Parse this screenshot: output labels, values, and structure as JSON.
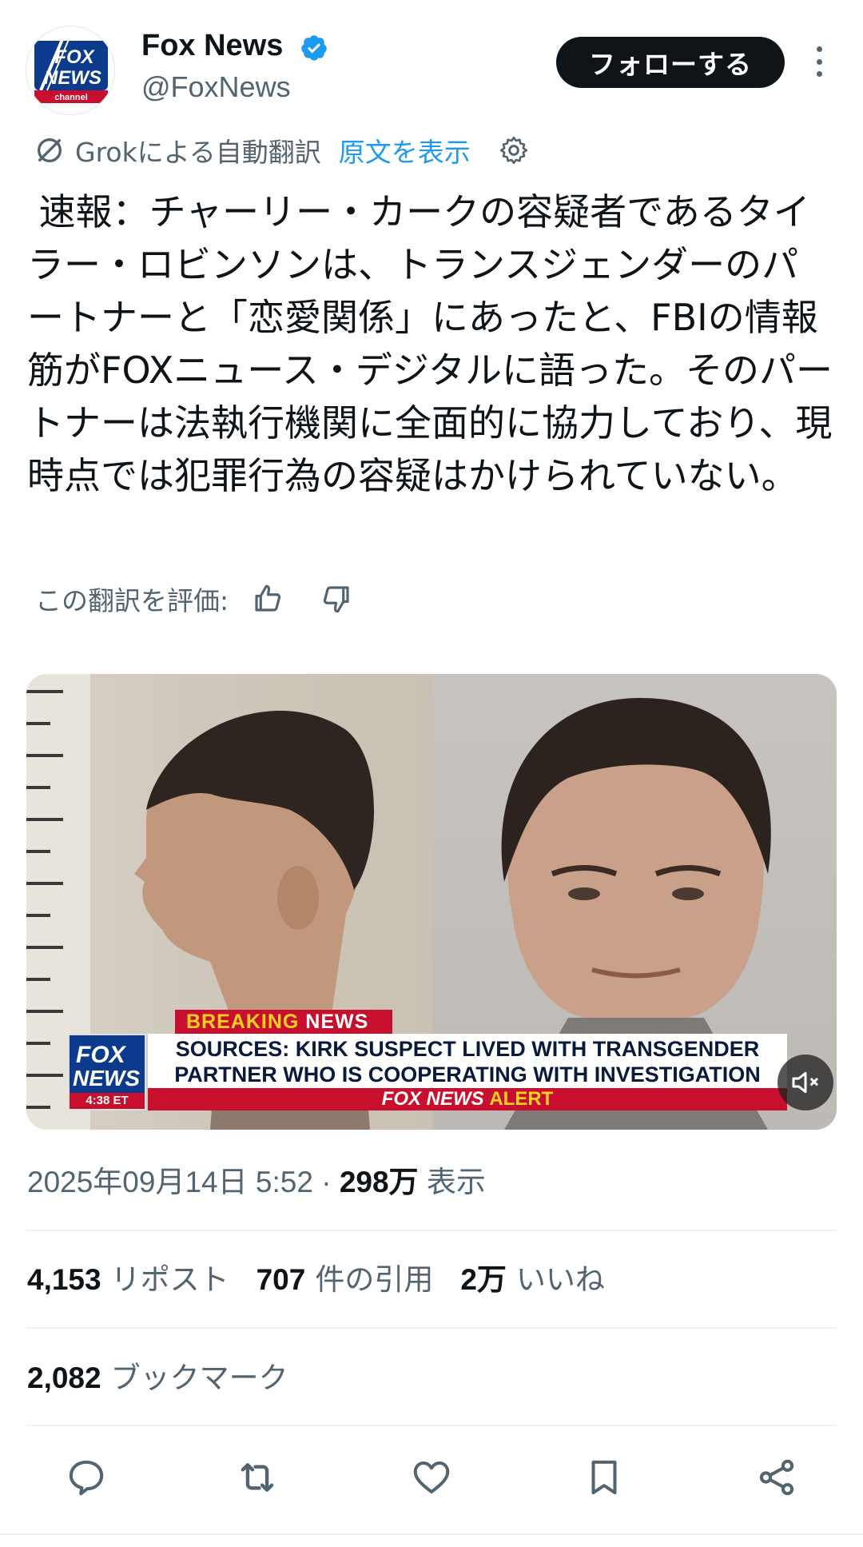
{
  "author": {
    "display_name": "Fox News",
    "handle": "@FoxNews",
    "verified": true,
    "avatar_logo_text": [
      "FOX",
      "NEWS",
      "channel"
    ]
  },
  "header": {
    "follow_label": "フォローする",
    "more_icon": "more-vertical-icon"
  },
  "translation": {
    "grok_label": "Grokによる自動翻訳",
    "show_original_label": "原文を表示",
    "settings_icon": "gear-icon"
  },
  "tweet": {
    "text": " 速報：チャーリー・カークの容疑者であるタイラー・ロビンソンは、トランスジェンダーのパートナーと「恋愛関係」にあったと、FBIの情報筋がFOXニュース・デジタルに語った。そのパートナーは法執行機関に全面的に協力しており、現時点では犯罪行為の容疑はかけられていない。"
  },
  "rate": {
    "label": "この翻訳を評価:",
    "up_icon": "thumbs-up-icon",
    "down_icon": "thumbs-down-icon"
  },
  "media": {
    "breaking_tag_a": "BREAKING",
    "breaking_tag_b": " NEWS",
    "logo_line1": "FOX",
    "logo_line2": "NEWS",
    "time": "4:38 ET",
    "headline_line1": "SOURCES: KIRK SUSPECT LIVED WITH TRANSGENDER",
    "headline_line2": "PARTNER WHO IS COOPERATING WITH INVESTIGATION",
    "alert_a": "FOX NEWS ",
    "alert_b": "ALERT",
    "mute_icon": "mute-icon"
  },
  "meta": {
    "datetime": "2025年09月14日 5:52",
    "separator": " · ",
    "views_count": "298万",
    "views_label": "表示"
  },
  "stats": {
    "reposts_count": "4,153",
    "reposts_label": "リポスト",
    "quotes_count": "707",
    "quotes_label": "件の引用",
    "likes_count": "2万",
    "likes_label": "いいね",
    "bookmarks_count": "2,082",
    "bookmarks_label": "ブックマーク"
  },
  "actions": [
    "reply-icon",
    "retweet-icon",
    "like-icon",
    "bookmark-icon",
    "share-icon"
  ],
  "colors": {
    "accent_blue": "#1d9bf0",
    "text_primary": "#0f1419",
    "text_secondary": "#536471",
    "fox_red": "#c8102e",
    "fox_blue": "#0c3a8c"
  }
}
